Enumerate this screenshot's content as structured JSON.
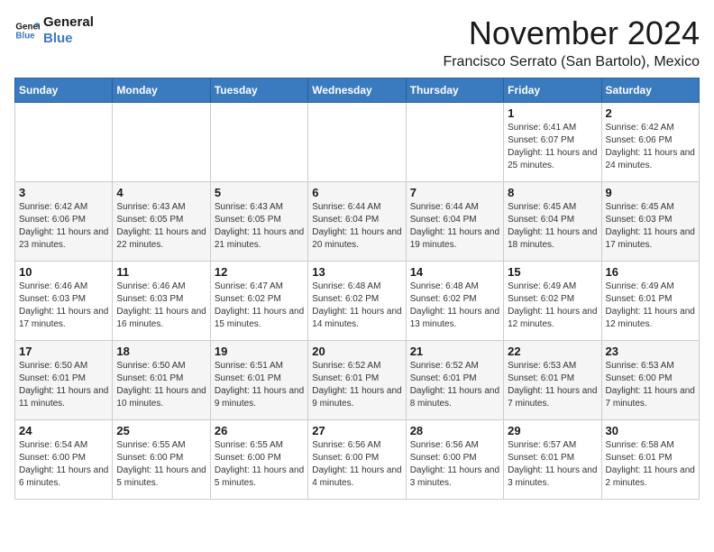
{
  "header": {
    "logo_line1": "General",
    "logo_line2": "Blue",
    "month": "November 2024",
    "location": "Francisco Serrato (San Bartolo), Mexico"
  },
  "days_of_week": [
    "Sunday",
    "Monday",
    "Tuesday",
    "Wednesday",
    "Thursday",
    "Friday",
    "Saturday"
  ],
  "weeks": [
    [
      {
        "day": "",
        "info": ""
      },
      {
        "day": "",
        "info": ""
      },
      {
        "day": "",
        "info": ""
      },
      {
        "day": "",
        "info": ""
      },
      {
        "day": "",
        "info": ""
      },
      {
        "day": "1",
        "info": "Sunrise: 6:41 AM\nSunset: 6:07 PM\nDaylight: 11 hours and 25 minutes."
      },
      {
        "day": "2",
        "info": "Sunrise: 6:42 AM\nSunset: 6:06 PM\nDaylight: 11 hours and 24 minutes."
      }
    ],
    [
      {
        "day": "3",
        "info": "Sunrise: 6:42 AM\nSunset: 6:06 PM\nDaylight: 11 hours and 23 minutes."
      },
      {
        "day": "4",
        "info": "Sunrise: 6:43 AM\nSunset: 6:05 PM\nDaylight: 11 hours and 22 minutes."
      },
      {
        "day": "5",
        "info": "Sunrise: 6:43 AM\nSunset: 6:05 PM\nDaylight: 11 hours and 21 minutes."
      },
      {
        "day": "6",
        "info": "Sunrise: 6:44 AM\nSunset: 6:04 PM\nDaylight: 11 hours and 20 minutes."
      },
      {
        "day": "7",
        "info": "Sunrise: 6:44 AM\nSunset: 6:04 PM\nDaylight: 11 hours and 19 minutes."
      },
      {
        "day": "8",
        "info": "Sunrise: 6:45 AM\nSunset: 6:04 PM\nDaylight: 11 hours and 18 minutes."
      },
      {
        "day": "9",
        "info": "Sunrise: 6:45 AM\nSunset: 6:03 PM\nDaylight: 11 hours and 17 minutes."
      }
    ],
    [
      {
        "day": "10",
        "info": "Sunrise: 6:46 AM\nSunset: 6:03 PM\nDaylight: 11 hours and 17 minutes."
      },
      {
        "day": "11",
        "info": "Sunrise: 6:46 AM\nSunset: 6:03 PM\nDaylight: 11 hours and 16 minutes."
      },
      {
        "day": "12",
        "info": "Sunrise: 6:47 AM\nSunset: 6:02 PM\nDaylight: 11 hours and 15 minutes."
      },
      {
        "day": "13",
        "info": "Sunrise: 6:48 AM\nSunset: 6:02 PM\nDaylight: 11 hours and 14 minutes."
      },
      {
        "day": "14",
        "info": "Sunrise: 6:48 AM\nSunset: 6:02 PM\nDaylight: 11 hours and 13 minutes."
      },
      {
        "day": "15",
        "info": "Sunrise: 6:49 AM\nSunset: 6:02 PM\nDaylight: 11 hours and 12 minutes."
      },
      {
        "day": "16",
        "info": "Sunrise: 6:49 AM\nSunset: 6:01 PM\nDaylight: 11 hours and 12 minutes."
      }
    ],
    [
      {
        "day": "17",
        "info": "Sunrise: 6:50 AM\nSunset: 6:01 PM\nDaylight: 11 hours and 11 minutes."
      },
      {
        "day": "18",
        "info": "Sunrise: 6:50 AM\nSunset: 6:01 PM\nDaylight: 11 hours and 10 minutes."
      },
      {
        "day": "19",
        "info": "Sunrise: 6:51 AM\nSunset: 6:01 PM\nDaylight: 11 hours and 9 minutes."
      },
      {
        "day": "20",
        "info": "Sunrise: 6:52 AM\nSunset: 6:01 PM\nDaylight: 11 hours and 9 minutes."
      },
      {
        "day": "21",
        "info": "Sunrise: 6:52 AM\nSunset: 6:01 PM\nDaylight: 11 hours and 8 minutes."
      },
      {
        "day": "22",
        "info": "Sunrise: 6:53 AM\nSunset: 6:01 PM\nDaylight: 11 hours and 7 minutes."
      },
      {
        "day": "23",
        "info": "Sunrise: 6:53 AM\nSunset: 6:00 PM\nDaylight: 11 hours and 7 minutes."
      }
    ],
    [
      {
        "day": "24",
        "info": "Sunrise: 6:54 AM\nSunset: 6:00 PM\nDaylight: 11 hours and 6 minutes."
      },
      {
        "day": "25",
        "info": "Sunrise: 6:55 AM\nSunset: 6:00 PM\nDaylight: 11 hours and 5 minutes."
      },
      {
        "day": "26",
        "info": "Sunrise: 6:55 AM\nSunset: 6:00 PM\nDaylight: 11 hours and 5 minutes."
      },
      {
        "day": "27",
        "info": "Sunrise: 6:56 AM\nSunset: 6:00 PM\nDaylight: 11 hours and 4 minutes."
      },
      {
        "day": "28",
        "info": "Sunrise: 6:56 AM\nSunset: 6:00 PM\nDaylight: 11 hours and 3 minutes."
      },
      {
        "day": "29",
        "info": "Sunrise: 6:57 AM\nSunset: 6:01 PM\nDaylight: 11 hours and 3 minutes."
      },
      {
        "day": "30",
        "info": "Sunrise: 6:58 AM\nSunset: 6:01 PM\nDaylight: 11 hours and 2 minutes."
      }
    ]
  ]
}
